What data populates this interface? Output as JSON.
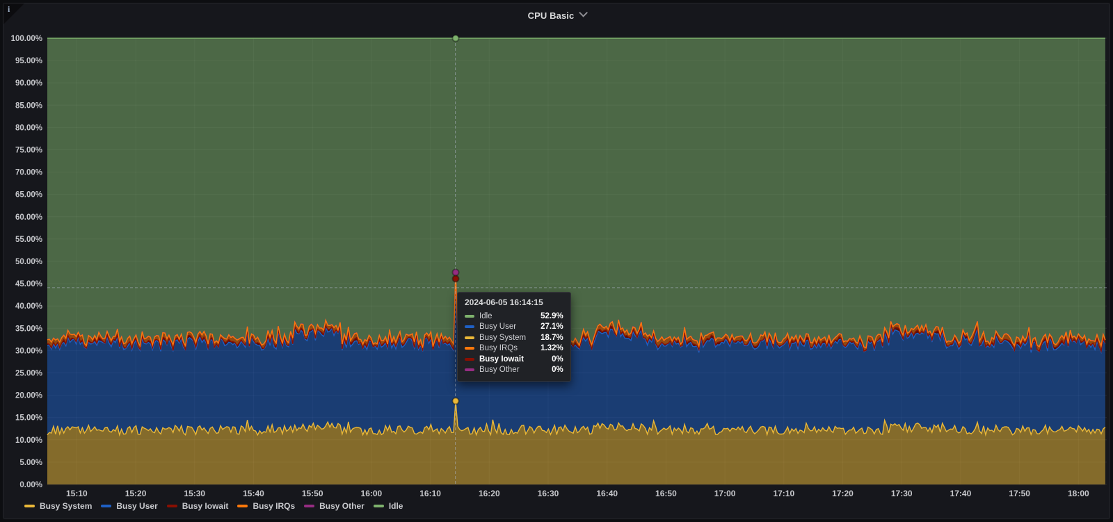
{
  "header": {
    "title": "CPU Basic",
    "menu_icon": "chevron-down"
  },
  "icons": {
    "info_glyph": "i"
  },
  "chart_data": {
    "type": "area",
    "stacked": true,
    "title": "CPU Basic",
    "ylabel_format": "percent",
    "ylim": [
      0,
      100
    ],
    "seed": 7,
    "t_min": 905,
    "t_max": 1084.8,
    "step": 0.35,
    "x_ticks": [
      {
        "t": 910,
        "label": "15:10"
      },
      {
        "t": 920,
        "label": "15:20"
      },
      {
        "t": 930,
        "label": "15:30"
      },
      {
        "t": 940,
        "label": "15:40"
      },
      {
        "t": 950,
        "label": "15:50"
      },
      {
        "t": 960,
        "label": "16:00"
      },
      {
        "t": 970,
        "label": "16:10"
      },
      {
        "t": 980,
        "label": "16:20"
      },
      {
        "t": 990,
        "label": "16:30"
      },
      {
        "t": 1000,
        "label": "16:40"
      },
      {
        "t": 1010,
        "label": "16:50"
      },
      {
        "t": 1020,
        "label": "17:00"
      },
      {
        "t": 1030,
        "label": "17:10"
      },
      {
        "t": 1040,
        "label": "17:20"
      },
      {
        "t": 1050,
        "label": "17:30"
      },
      {
        "t": 1060,
        "label": "17:40"
      },
      {
        "t": 1070,
        "label": "17:50"
      },
      {
        "t": 1080,
        "label": "18:00"
      }
    ],
    "y_ticks": [
      {
        "v": 100,
        "label": "100.00%"
      },
      {
        "v": 95,
        "label": "95.00%"
      },
      {
        "v": 90,
        "label": "90.00%"
      },
      {
        "v": 85,
        "label": "85.00%"
      },
      {
        "v": 80,
        "label": "80.00%"
      },
      {
        "v": 75,
        "label": "75.00%"
      },
      {
        "v": 70,
        "label": "70.00%"
      },
      {
        "v": 65,
        "label": "65.00%"
      },
      {
        "v": 60,
        "label": "60.00%"
      },
      {
        "v": 55,
        "label": "55.00%"
      },
      {
        "v": 50,
        "label": "50.00%"
      },
      {
        "v": 45,
        "label": "45.00%"
      },
      {
        "v": 40,
        "label": "40.00%"
      },
      {
        "v": 35,
        "label": "35.00%"
      },
      {
        "v": 30,
        "label": "30.00%"
      },
      {
        "v": 25,
        "label": "25.00%"
      },
      {
        "v": 20,
        "label": "20.00%"
      },
      {
        "v": 15,
        "label": "15.00%"
      },
      {
        "v": 10,
        "label": "10.00%"
      },
      {
        "v": 5,
        "label": "5.00%"
      },
      {
        "v": 0,
        "label": "0.00%"
      }
    ],
    "series": [
      {
        "key": "busy_system",
        "name": "Busy System",
        "color": "#EAB839",
        "base": 12.2,
        "noise": 1.1,
        "bump_p": 0.05,
        "bump_amp": 1.8,
        "paint": 0
      },
      {
        "key": "busy_user",
        "name": "Busy User",
        "color": "#1F60C4",
        "base": 19.2,
        "noise": 0.9,
        "bump_p": 0.05,
        "bump_amp": 2.0,
        "paint": 1
      },
      {
        "key": "busy_iowait",
        "name": "Busy Iowait",
        "color": "#890F02",
        "base": 0.4,
        "noise": 0.35,
        "paint": 2
      },
      {
        "key": "busy_irqs",
        "name": "Busy IRQs",
        "color": "#FF780A",
        "base": 0.9,
        "noise": 0.4,
        "paint": 4
      },
      {
        "key": "busy_other",
        "name": "Busy Other",
        "color": "#962D82",
        "base": 0.05,
        "noise": 0.04,
        "paint": 3
      },
      {
        "key": "idle",
        "name": "Idle",
        "color": "#7EB26D",
        "remainder": true,
        "paint": 5
      }
    ],
    "bumps": [
      {
        "from": 947,
        "to": 955,
        "add": {
          "busy_user": 2.2,
          "busy_system": 0.8
        }
      },
      {
        "from": 998,
        "to": 1006,
        "add": {
          "busy_user": 2.0,
          "busy_system": 0.6
        }
      },
      {
        "from": 1048,
        "to": 1057,
        "add": {
          "busy_user": 2.0,
          "busy_system": 0.6
        }
      },
      {
        "from": 1060,
        "to": 1063,
        "add": {
          "busy_user": 1.5
        }
      }
    ],
    "spike": {
      "time_label": "2024-06-05 16:14:15",
      "t": 974.25,
      "values": {
        "busy_system": 18.7,
        "busy_user": 27.1,
        "busy_iowait": 0.3,
        "busy_irqs": 1.32,
        "busy_other": 0.1
      }
    },
    "crosshair": {
      "t": 974.25,
      "v": 44.1
    },
    "marker_keys": [
      "idle",
      "busy_other",
      "busy_iowait",
      "busy_system"
    ],
    "tooltip": {
      "title": "2024-06-05 16:14:15",
      "rows": [
        {
          "name": "Idle",
          "value": "52.9%",
          "color": "#7EB26D",
          "hovered": false
        },
        {
          "name": "Busy User",
          "value": "27.1%",
          "color": "#1F60C4",
          "hovered": false
        },
        {
          "name": "Busy System",
          "value": "18.7%",
          "color": "#EAB839",
          "hovered": false
        },
        {
          "name": "Busy IRQs",
          "value": "1.32%",
          "color": "#FF780A",
          "hovered": false
        },
        {
          "name": "Busy Iowait",
          "value": "0%",
          "color": "#890F02",
          "hovered": true
        },
        {
          "name": "Busy Other",
          "value": "0%",
          "color": "#962D82",
          "hovered": false
        }
      ]
    },
    "legend": [
      {
        "name": "Busy System",
        "color": "#EAB839"
      },
      {
        "name": "Busy User",
        "color": "#1F60C4"
      },
      {
        "name": "Busy Iowait",
        "color": "#890F02"
      },
      {
        "name": "Busy IRQs",
        "color": "#FF780A"
      },
      {
        "name": "Busy Other",
        "color": "#962D82"
      },
      {
        "name": "Idle",
        "color": "#7EB26D"
      }
    ]
  }
}
